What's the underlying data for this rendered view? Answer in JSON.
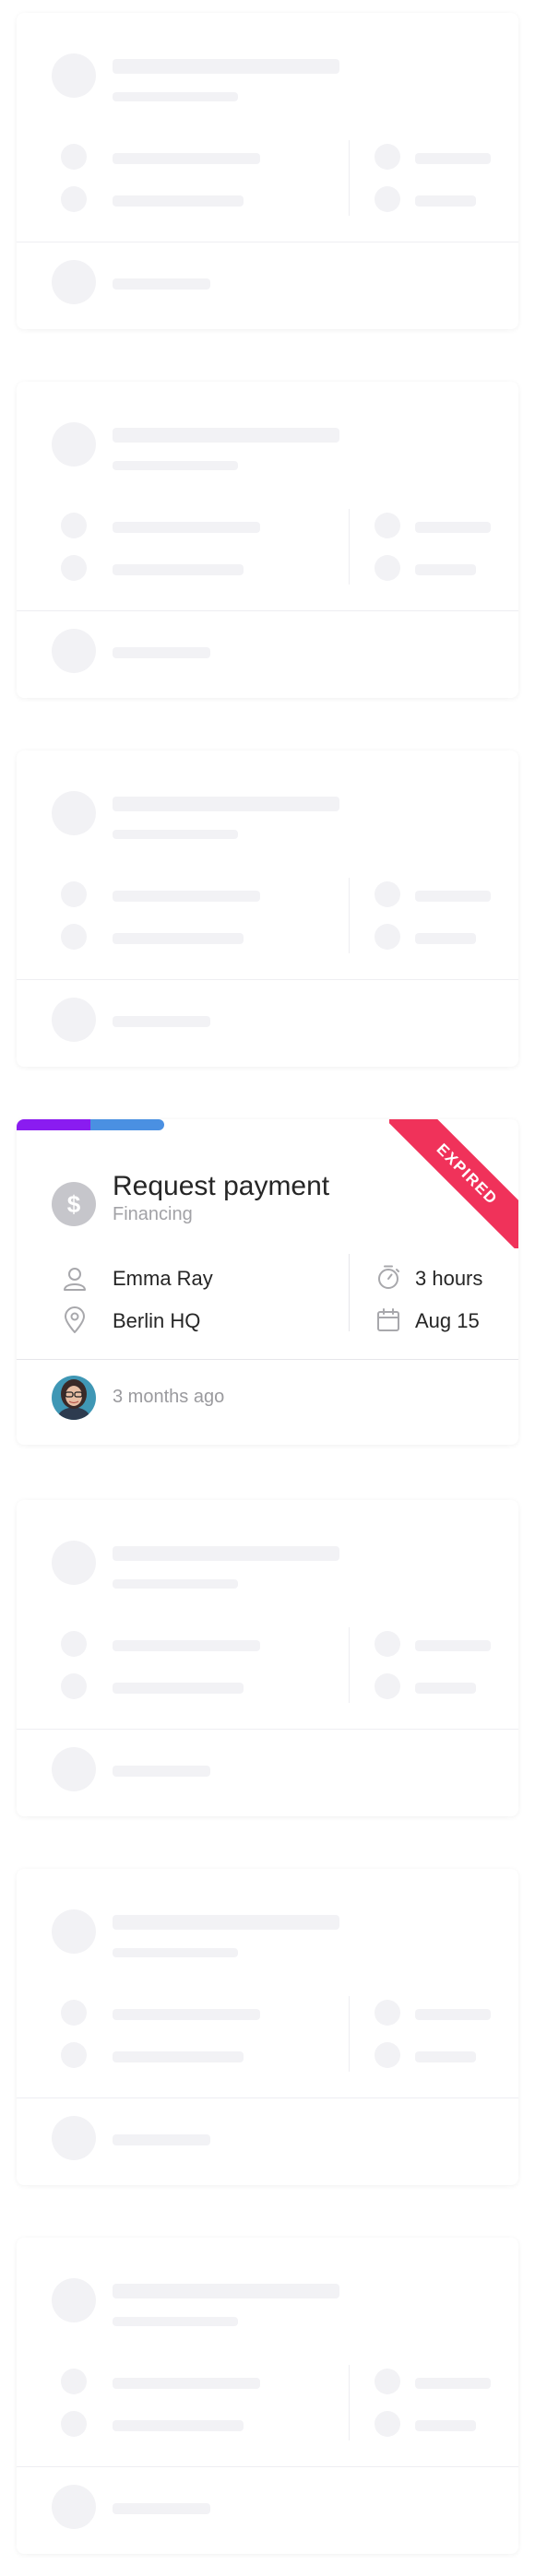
{
  "active_card": {
    "title": "Request payment",
    "category": "Financing",
    "assignee": "Emma Ray",
    "location": "Berlin HQ",
    "duration": "3 hours",
    "date": "Aug 15",
    "ribbon": "EXPIRED",
    "updated": "3 months ago",
    "type_icon": "dollar-icon",
    "progress_colors": [
      "#8a1cf0",
      "#4a90e2"
    ],
    "ribbon_color": "#f0325a"
  },
  "skeleton_cards_count": 6
}
